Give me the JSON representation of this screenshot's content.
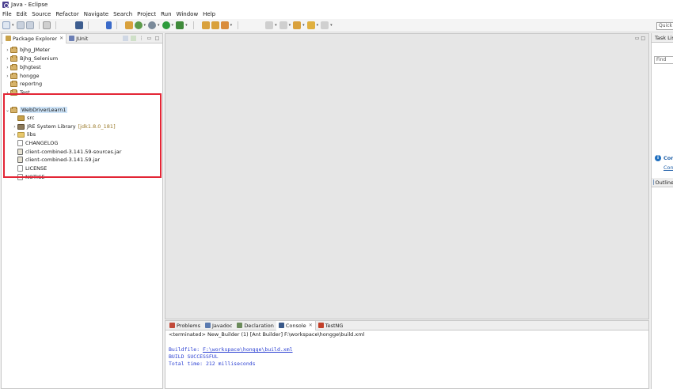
{
  "window": {
    "title": "Java - Eclipse"
  },
  "menu": [
    "File",
    "Edit",
    "Source",
    "Refactor",
    "Navigate",
    "Search",
    "Project",
    "Run",
    "Window",
    "Help"
  ],
  "toolbar": {
    "quick_access_placeholder": "Quick Access"
  },
  "left_tabs": [
    {
      "label": "Package Explorer",
      "active": true,
      "icon": "package-explorer-icon"
    },
    {
      "label": "JUnit",
      "active": false,
      "icon": "junit-icon"
    }
  ],
  "tree": [
    {
      "label": "bjhg_JMeter",
      "twisty": "›",
      "icon": "project",
      "depth": 0
    },
    {
      "label": "Bjhg_Selenium",
      "twisty": "›",
      "icon": "project",
      "depth": 0
    },
    {
      "label": "bjhgtest",
      "twisty": "›",
      "icon": "project",
      "depth": 0
    },
    {
      "label": "hongge",
      "twisty": "›",
      "icon": "project",
      "depth": 0
    },
    {
      "label": "reportng",
      "twisty": "",
      "icon": "project",
      "depth": 0
    },
    {
      "label": "Test",
      "twisty": "›",
      "icon": "project",
      "depth": 0
    },
    {
      "label": "WebDriverLearn1",
      "twisty": "⌄",
      "icon": "project",
      "depth": 0,
      "selected": true
    },
    {
      "label": "src",
      "twisty": "",
      "icon": "pkg",
      "depth": 1
    },
    {
      "label": "JRE System Library",
      "decor": "[jdk1.8.0_181]",
      "twisty": "›",
      "icon": "lib",
      "depth": 1
    },
    {
      "label": "libs",
      "twisty": "›",
      "icon": "folder",
      "depth": 1
    },
    {
      "label": "CHANGELOG",
      "twisty": "",
      "icon": "file",
      "depth": 1
    },
    {
      "label": "client-combined-3.141.59-sources.jar",
      "twisty": "",
      "icon": "jar",
      "depth": 1
    },
    {
      "label": "client-combined-3.141.59.jar",
      "twisty": "",
      "icon": "jar",
      "depth": 1
    },
    {
      "label": "LICENSE",
      "twisty": "",
      "icon": "file",
      "depth": 1
    },
    {
      "label": "NOTICE",
      "twisty": "",
      "icon": "file",
      "depth": 1
    }
  ],
  "right_panel": {
    "task_tab": "Task List",
    "find_placeholder": "Find",
    "connect_title": "Connect Mylyn",
    "connect_link": "Connect",
    "outline_tab": "Outline"
  },
  "bottom_tabs": [
    {
      "label": "Problems",
      "icon": "problems-icon",
      "active": false
    },
    {
      "label": "Javadoc",
      "icon": "javadoc-icon",
      "active": false
    },
    {
      "label": "Declaration",
      "icon": "declaration-icon",
      "active": false
    },
    {
      "label": "Console",
      "icon": "console-icon",
      "active": true
    },
    {
      "label": "TestNG",
      "icon": "testng-icon",
      "active": false
    }
  ],
  "console": {
    "status": "<terminated> New_Builder (1) [Ant Builder] F:\\workspace\\hongge\\build.xml",
    "lines": [
      {
        "prefix": "Buildfile: ",
        "link": "F:\\workspace\\hongge\\build.xml"
      },
      {
        "prefix": "BUILD SUCCESSFUL",
        "link": ""
      },
      {
        "prefix": "Total time: 212 milliseconds",
        "link": ""
      }
    ]
  },
  "colors": {
    "highlight": "#e32636",
    "console_text": "#2a3fd2",
    "selection": "#cde3f7"
  }
}
